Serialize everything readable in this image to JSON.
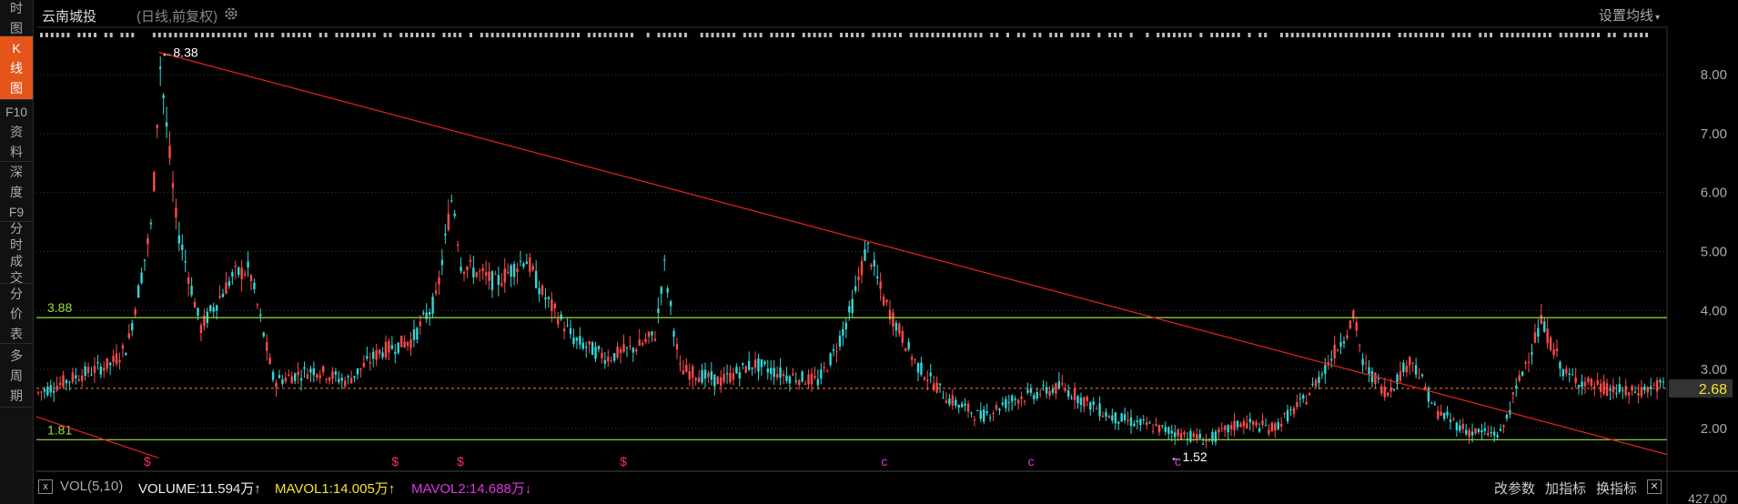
{
  "sidebar": {
    "tabs": [
      {
        "label": "时\n图",
        "active": false
      },
      {
        "label": "K\n线\n图",
        "active": true
      },
      {
        "label": "F10\n资\n料",
        "active": false
      },
      {
        "label": "深\n度\nF9",
        "active": false
      },
      {
        "label": "分\n时\n成\n交",
        "active": false
      },
      {
        "label": "分\n价\n表",
        "active": false
      },
      {
        "label": "多\n周\n期",
        "active": false
      }
    ]
  },
  "header": {
    "title": "云南城投",
    "subtitle": "(日线,前复权)",
    "set_ma_label": "设置均线"
  },
  "chart": {
    "price_axis": [
      "8.00",
      "7.00",
      "6.00",
      "5.00",
      "4.00",
      "3.00",
      "2.00"
    ],
    "current_price": "2.68",
    "support_levels": [
      {
        "label": "3.88",
        "value": 3.88
      },
      {
        "label": "1.81",
        "value": 1.81
      }
    ],
    "current_line": 2.68,
    "high_label": "8.38",
    "low_label": "1.52",
    "volume_axis_label": "427.00",
    "trendlines": [
      {
        "from": [
          0.075,
          8.38
        ],
        "to": [
          1.0,
          1.56
        ]
      },
      {
        "from": [
          0.0,
          2.2
        ],
        "to": [
          0.075,
          1.5
        ]
      }
    ],
    "event_markers": [
      "$",
      "$",
      "$",
      "$",
      "c",
      "c",
      "c"
    ],
    "colors": {
      "up": "#ff4a4a",
      "down": "#31d8d8",
      "support": "#9be03a",
      "trend": "#e8231d",
      "current": "#ff7b2a"
    }
  },
  "volume_bar": {
    "close_box": "x",
    "vol_label": "VOL(5,10)",
    "volume": "VOLUME:11.594万",
    "mavol1": "MAVOL1:14.005万",
    "mavol2": "MAVOL2:14.688万",
    "up_arrow": "↑",
    "down_arrow": "↓",
    "btn_params": "改参数",
    "btn_add": "加指标",
    "btn_switch": "换指标",
    "close_x": "✕"
  }
}
